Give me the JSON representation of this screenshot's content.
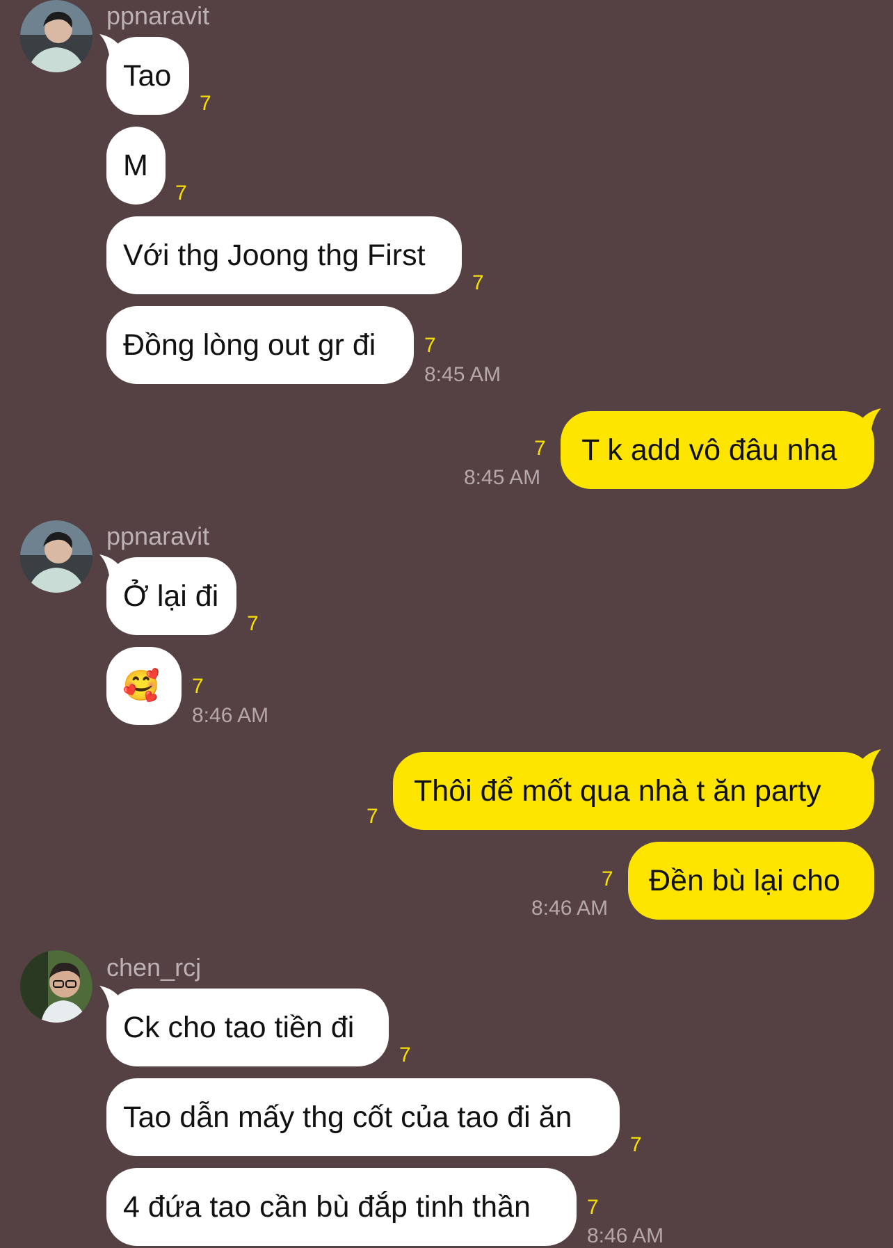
{
  "colors": {
    "background": "#554043",
    "incoming_bubble": "#ffffff",
    "outgoing_bubble": "#fee500",
    "unread_count": "#f7e000"
  },
  "groups": [
    {
      "sender": "ppnaravit",
      "avatar": "avatar-ppnaravit",
      "messages": [
        {
          "text": "Tao",
          "unread": "7"
        },
        {
          "text": "M",
          "unread": "7"
        },
        {
          "text": "Với thg Joong thg First",
          "unread": "7"
        },
        {
          "text": "Đồng lòng out gr đi",
          "unread": "7",
          "time": "8:45 AM"
        }
      ]
    },
    {
      "sender": "me",
      "messages": [
        {
          "text": "T k add vô đâu nha",
          "unread": "7",
          "time": "8:45 AM"
        }
      ]
    },
    {
      "sender": "ppnaravit",
      "avatar": "avatar-ppnaravit",
      "messages": [
        {
          "text": "Ở lại đi",
          "unread": "7"
        },
        {
          "text": "🥰",
          "unread": "7",
          "time": "8:46 AM"
        }
      ]
    },
    {
      "sender": "me",
      "messages": [
        {
          "text": "Thôi để mốt qua nhà t ăn party",
          "unread": "7"
        },
        {
          "text": "Đền bù lại cho",
          "unread": "7",
          "time": "8:46 AM"
        }
      ]
    },
    {
      "sender": "chen_rcj",
      "avatar": "avatar-chen_rcj",
      "messages": [
        {
          "text": "Ck cho tao tiền đi",
          "unread": "7"
        },
        {
          "text": "Tao dẫn mấy thg cốt của tao đi ăn",
          "unread": "7"
        },
        {
          "text": "4 đứa tao cần bù đắp tinh thần",
          "unread": "7",
          "time": "8:46 AM"
        }
      ]
    }
  ]
}
